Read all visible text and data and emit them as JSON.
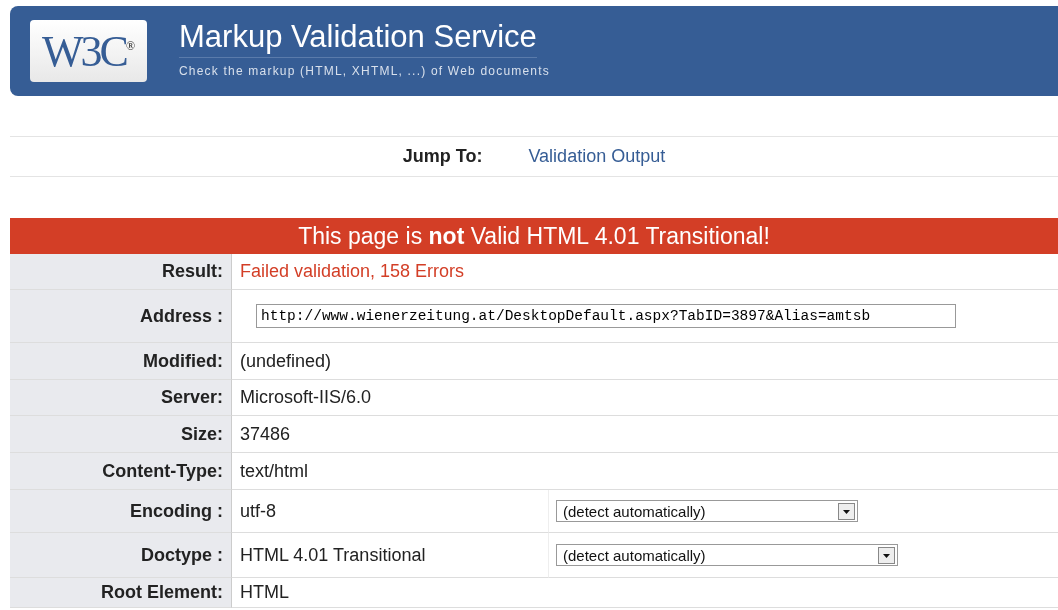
{
  "header": {
    "logo": {
      "text": "W3C",
      "mark": "®"
    },
    "title": "Markup Validation Service",
    "subtitle": "Check the markup (HTML, XHTML, ...) of Web documents"
  },
  "jump": {
    "label": "Jump To:",
    "link": "Validation Output"
  },
  "banner": "This page is **not** Valid HTML 4.01 Transitional!",
  "rows": [
    {
      "kind": "error",
      "label": "Result:",
      "value": "Failed validation, 158 Errors"
    },
    {
      "kind": "field",
      "label": "Address :",
      "value": "http://www.wienerzeitung.at/DesktopDefault.aspx?TabID=3897&Alias=amtsb"
    },
    {
      "kind": "text",
      "label": "Modified:",
      "value": "(undefined)"
    },
    {
      "kind": "text",
      "label": "Server:",
      "value": "Microsoft-IIS/6.0"
    },
    {
      "kind": "text",
      "label": "Size:",
      "value": "37486"
    },
    {
      "kind": "text",
      "label": "Content-Type:",
      "value": "text/html"
    },
    {
      "kind": "select",
      "label": "Encoding :",
      "value": "utf-8",
      "option": "(detect automatically)"
    },
    {
      "kind": "select",
      "label": "Doctype :",
      "value": "HTML 4.01 Transitional",
      "option": "(detect automatically)",
      "wide": true
    },
    {
      "kind": "text",
      "label": "Root Element:",
      "value": "HTML"
    }
  ]
}
